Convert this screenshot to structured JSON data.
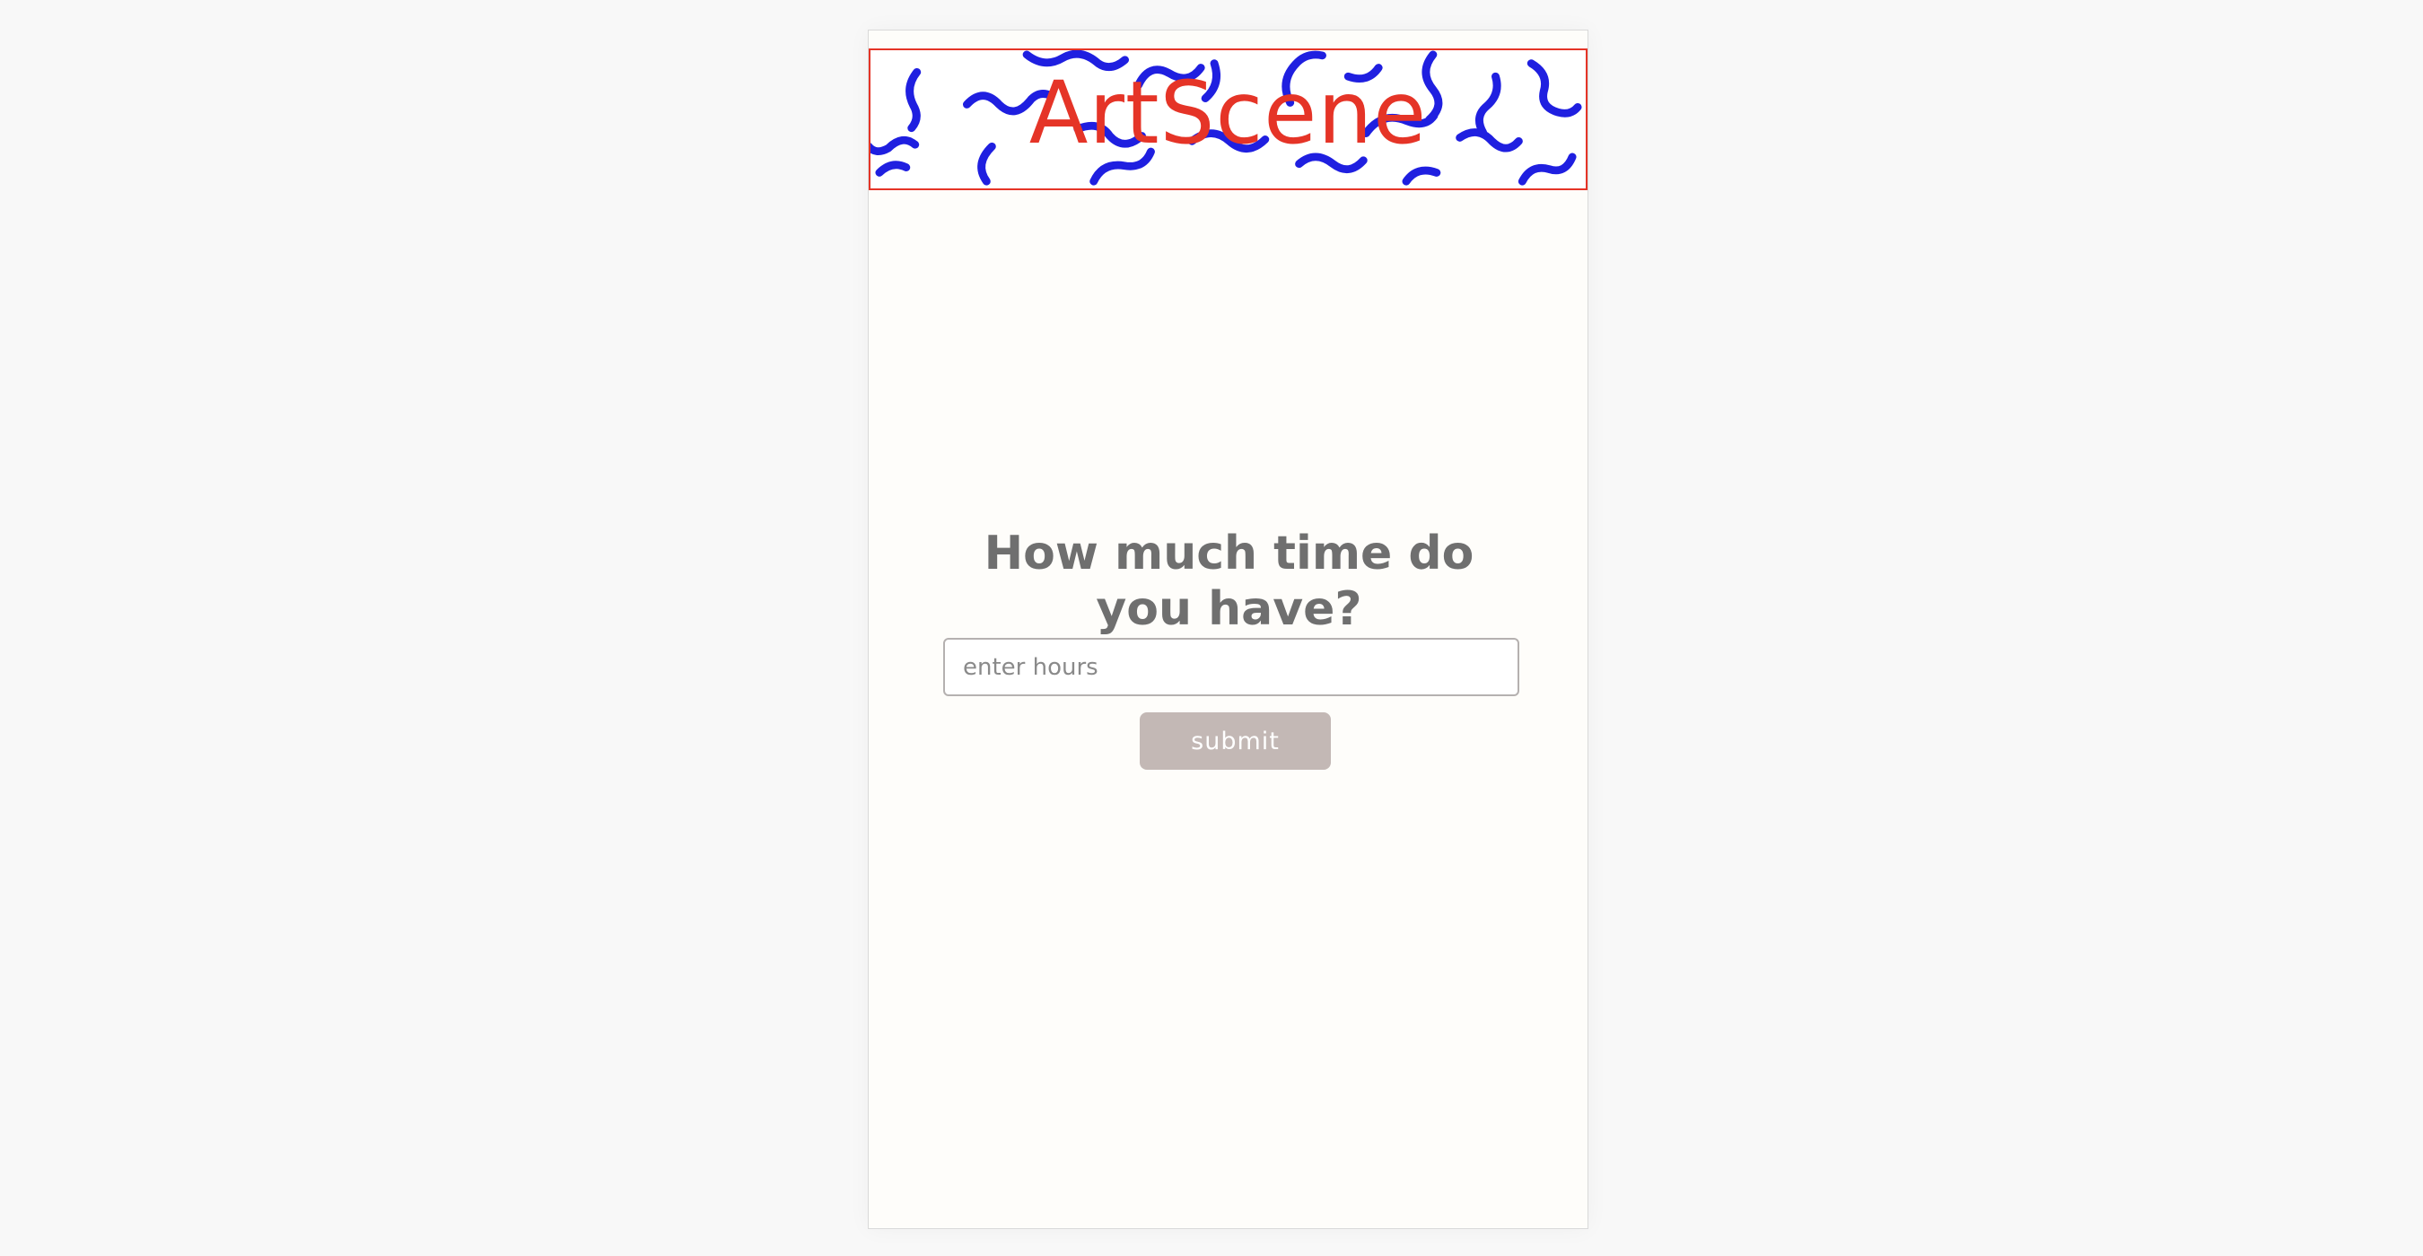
{
  "header": {
    "logo_text": "ArtScene"
  },
  "main": {
    "prompt": "How much time do you have?",
    "hours_input": {
      "value": "",
      "placeholder": "enter hours"
    },
    "submit_label": "submit"
  },
  "colors": {
    "brand_red": "#e53427",
    "squiggle_blue": "#1f1fe0",
    "button_bg": "#c3b8b5",
    "prompt_text": "#6f6f6f",
    "page_bg": "#fefdfa"
  }
}
